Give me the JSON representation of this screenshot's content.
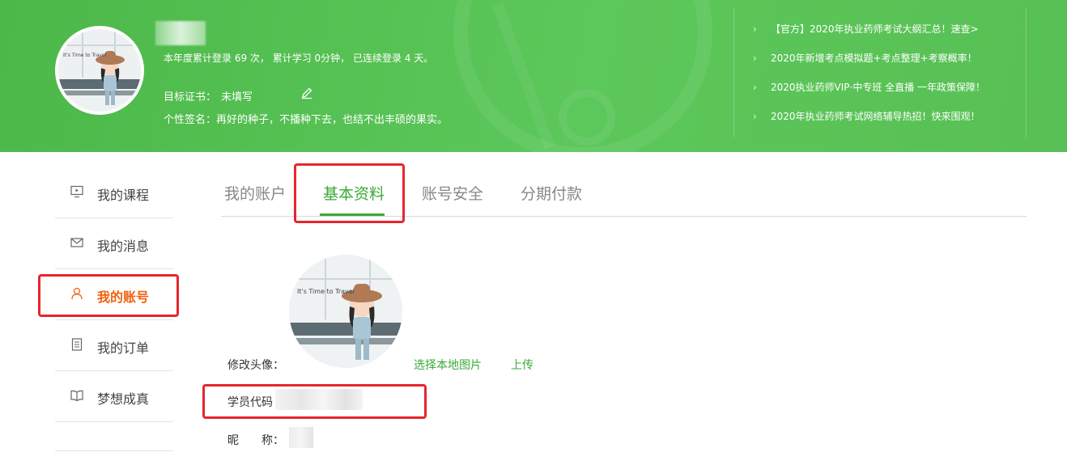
{
  "header": {
    "stats_text": "本年度累计登录 69 次， 累计学习 0分钟， 已连续登录 4 天。",
    "goal_label": "目标证书：",
    "goal_value": "未填写",
    "sign_label": "个性签名：",
    "sign_value": "再好的种子，不播种下去，也结不出丰硕的果实。",
    "news": [
      "【官方】2020年执业药师考试大纲汇总！速查>",
      "2020年新增考点模拟题+考点整理+考察概率！",
      "2020执业药师VIP·中专班 全直播 一年政策保障！",
      "2020年执业药师考试网络辅导热招！快来围观！"
    ],
    "avatar_sign_text": "It's Time to Travel"
  },
  "sidebar": {
    "items": [
      {
        "label": "我的课程",
        "icon": "monitor-icon"
      },
      {
        "label": "我的消息",
        "icon": "envelope-icon"
      },
      {
        "label": "我的账号",
        "icon": "user-icon",
        "active": true
      },
      {
        "label": "我的订单",
        "icon": "document-icon"
      },
      {
        "label": "梦想成真",
        "icon": "book-icon"
      }
    ]
  },
  "tabs": [
    {
      "label": "我的账户"
    },
    {
      "label": "基本资料",
      "active": true
    },
    {
      "label": "账号安全"
    },
    {
      "label": "分期付款"
    }
  ],
  "form": {
    "avatar_label": "修改头像：",
    "choose_local": "选择本地图片",
    "upload": "上传",
    "student_code_label": "学员代码",
    "nickname_label": "昵　　称："
  },
  "colors": {
    "banner_green": "#55c152",
    "accent_green": "#3aaa35",
    "active_orange": "#f0620f",
    "highlight_red": "#e7262d"
  }
}
